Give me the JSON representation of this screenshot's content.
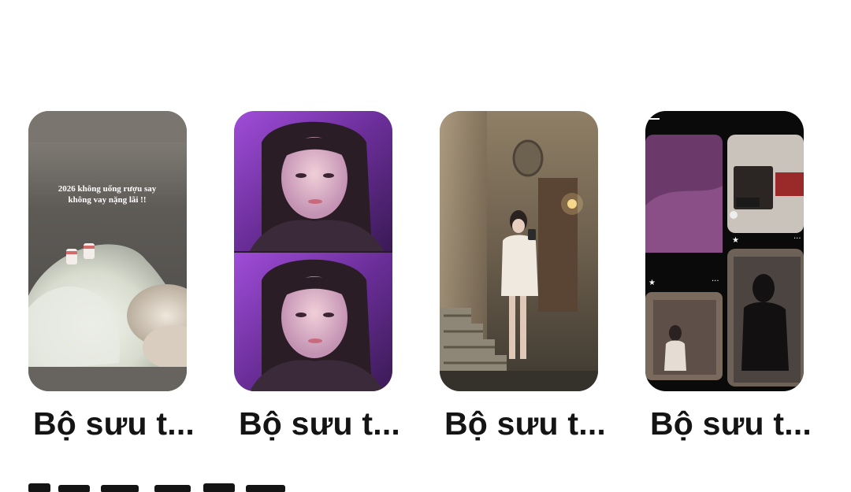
{
  "collections": [
    {
      "title": "Bộ sưu t...",
      "caption_line1": "2026 không uống rượu say",
      "caption_line2": "không vay nặng lãi !!"
    },
    {
      "title": "Bộ sưu t..."
    },
    {
      "title": "Bộ sưu t..."
    },
    {
      "title": "Bộ sưu t..."
    }
  ],
  "colors": {
    "title_text": "#141414",
    "background": "#ffffff"
  }
}
